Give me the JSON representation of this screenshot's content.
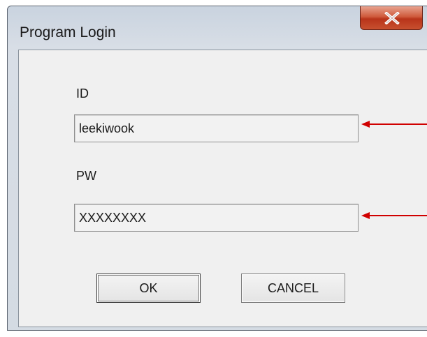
{
  "window": {
    "title": "Program Login",
    "close_icon": "close-icon"
  },
  "form": {
    "id_label": "ID",
    "id_value": "leekiwook",
    "pw_label": "PW",
    "pw_value": "XXXXXXXX"
  },
  "buttons": {
    "ok_label": "OK",
    "cancel_label": "CANCEL"
  },
  "annotations": {
    "arrow_color": "#d00000"
  }
}
